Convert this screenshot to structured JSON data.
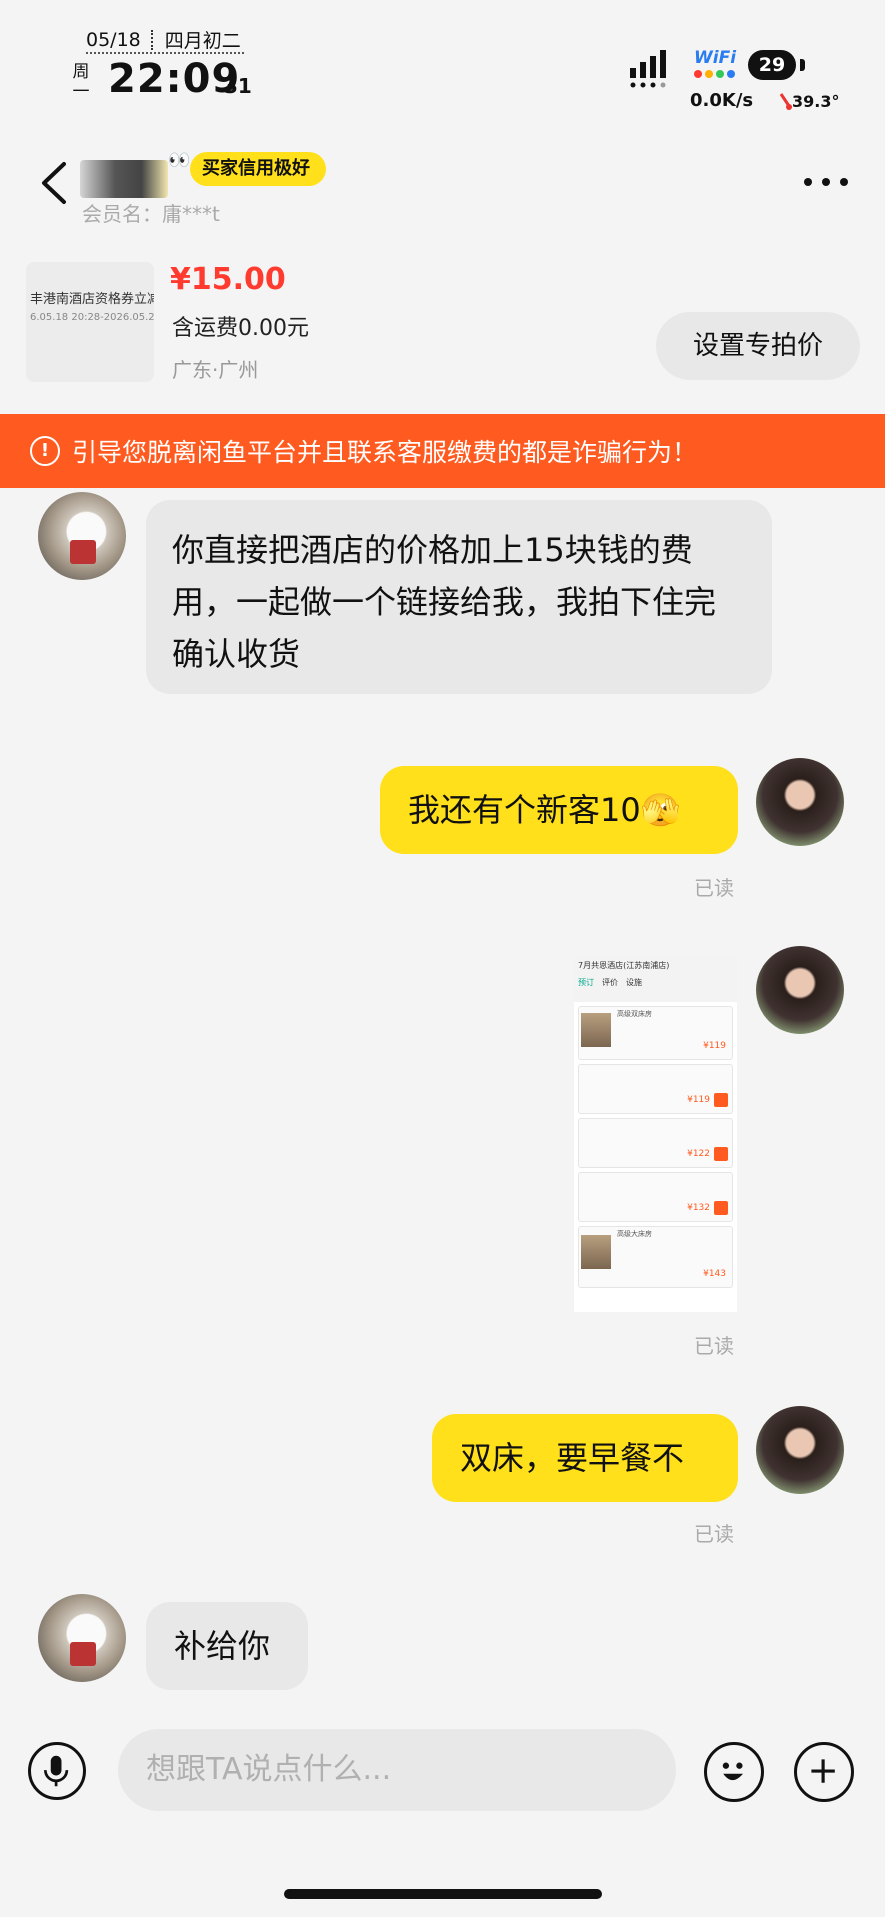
{
  "status_bar": {
    "date": "05/18",
    "lunar": "四月初二",
    "weekday": "周一",
    "time": "22:09",
    "seconds": "31",
    "wifi_label": "WiFi",
    "battery": "29",
    "net_speed": "0.0K/s",
    "temperature": "39.3°"
  },
  "header": {
    "nickname_partial": "…",
    "credit_badge": "买家信用极好",
    "member_label": "会员名：庸***t"
  },
  "product": {
    "thumb_title": "丰港南酒店资格券立减",
    "thumb_date": "6.05.18 20:28-2026.05.2",
    "price": "¥15.00",
    "shipping": "含运费0.00元",
    "location": "广东·广州",
    "set_price_button": "设置专拍价"
  },
  "warning": {
    "icon": "!",
    "text": "引导您脱离闲鱼平台并且联系客服缴费的都是诈骗行为！"
  },
  "messages": [
    {
      "side": "in",
      "text": "你直接把酒店的价格加上15块钱的费用，一起做一个链接给我，我拍下住完确认收货"
    },
    {
      "side": "out",
      "text": "我还有个新客10🫣",
      "status": "已读"
    },
    {
      "side": "out",
      "type": "image",
      "status": "已读",
      "image_texts": {
        "header": "7月共恩酒店(江苏南浦店)",
        "tabs": [
          "预订",
          "评价",
          "设施"
        ],
        "room1": "高级双床房",
        "room1_price": "¥119",
        "plan_prices": [
          "¥119",
          "¥122",
          "¥132"
        ],
        "room2": "高级大床房",
        "room2_price": "¥143",
        "book_label": "订"
      }
    },
    {
      "side": "out",
      "text": "双床，要早餐不",
      "status": "已读"
    },
    {
      "side": "in",
      "text": "补给你"
    }
  ],
  "input_bar": {
    "placeholder": "想跟TA说点什么..."
  },
  "colors": {
    "accent_yellow": "#ffe01b",
    "warning_orange": "#ff5a1f",
    "price_red": "#ff3b30"
  }
}
